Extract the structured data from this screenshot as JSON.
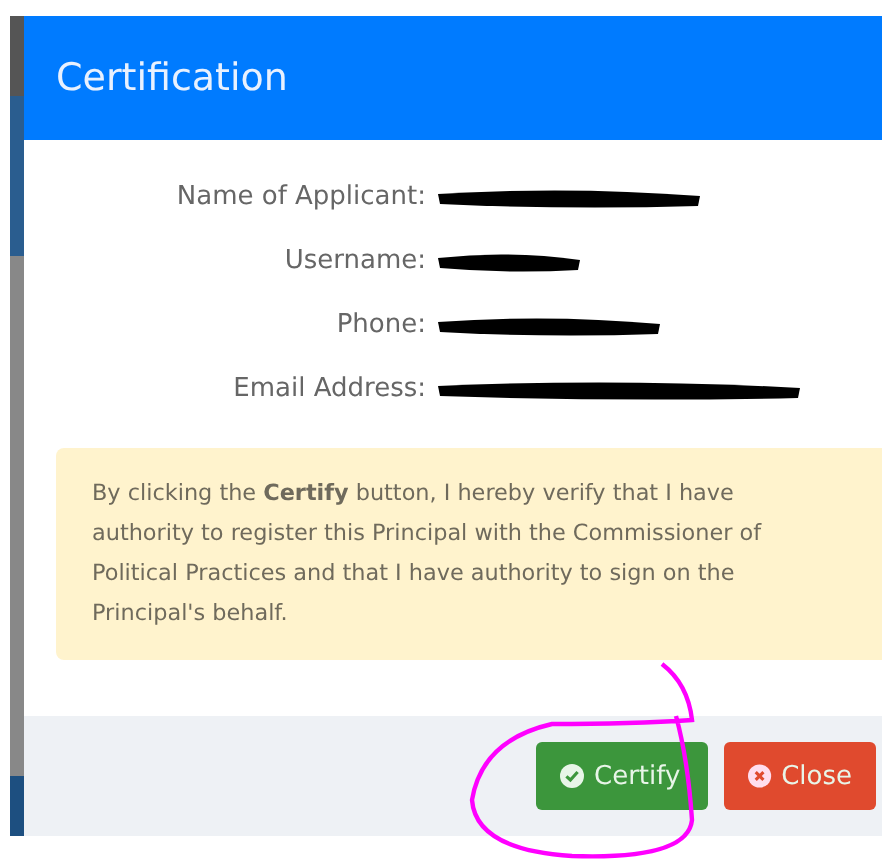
{
  "dialog": {
    "title": "Certification",
    "fields": [
      {
        "label": "Name of Applicant:"
      },
      {
        "label": "Username:"
      },
      {
        "label": "Phone:"
      },
      {
        "label": "Email Address:"
      }
    ],
    "notice": "By clicking the **Certify** button, I hereby verify that I have authority to register this Principal with the Commissioner of Political Practices and that I have authority to sign on the Principal's behalf.",
    "buttons": [
      {
        "label": "Certify",
        "kind": "certify"
      },
      {
        "label": "Close",
        "kind": "close"
      }
    ]
  }
}
